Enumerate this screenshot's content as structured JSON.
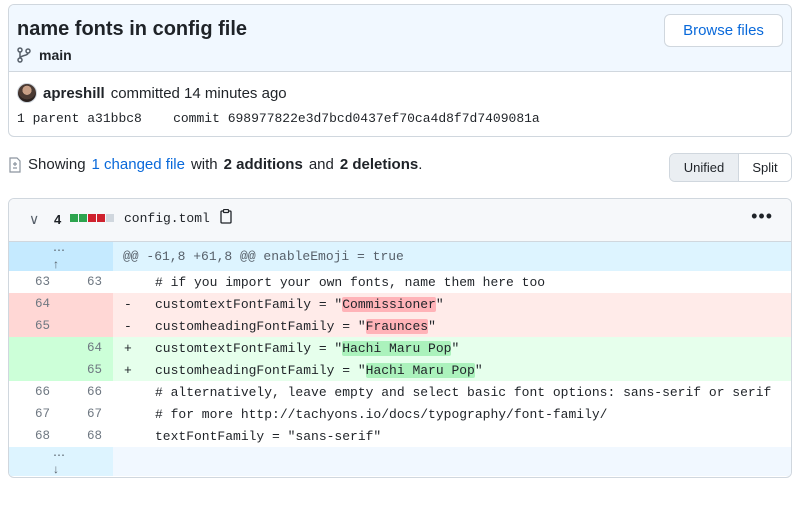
{
  "commit": {
    "title": "name fonts in config file",
    "branch": "main",
    "browse_label": "Browse files",
    "author": "apreshill",
    "action": "committed 14 minutes ago",
    "parent_label": "1 parent",
    "parent_sha": "a31bbc8",
    "commit_label": "commit",
    "commit_sha": "698977822e3d7bcd0437ef70ca4d8f7d7409081a"
  },
  "summary": {
    "showing": "Showing",
    "changed_link": "1 changed file",
    "with": "with",
    "additions": "2 additions",
    "and": "and",
    "deletions": "2 deletions",
    "period": "."
  },
  "view": {
    "unified": "Unified",
    "split": "Split"
  },
  "file": {
    "count": "4",
    "name": "config.toml",
    "diffstat": [
      "add",
      "add",
      "del",
      "del",
      "neutral"
    ],
    "colors": {
      "add": "#2da44e",
      "del": "#cf222e",
      "neutral": "#d0d7de"
    }
  },
  "diff": {
    "hunk_header": "@@ -61,8 +61,8 @@ enableEmoji = true",
    "lines": [
      {
        "type": "ctx",
        "old": "63",
        "new": "63",
        "sign": "",
        "pre": "# if you import your own fonts, name them here too",
        "hl": "",
        "post": ""
      },
      {
        "type": "del",
        "old": "64",
        "new": "",
        "sign": "-",
        "pre": "customtextFontFamily = \"",
        "hl": "Commissioner",
        "post": "\""
      },
      {
        "type": "del",
        "old": "65",
        "new": "",
        "sign": "-",
        "pre": "customheadingFontFamily = \"",
        "hl": "Fraunces",
        "post": "\""
      },
      {
        "type": "add",
        "old": "",
        "new": "64",
        "sign": "+",
        "pre": "customtextFontFamily = \"",
        "hl": "Hachi Maru Pop",
        "post": "\""
      },
      {
        "type": "add",
        "old": "",
        "new": "65",
        "sign": "+",
        "pre": "customheadingFontFamily = \"",
        "hl": "Hachi Maru Pop",
        "post": "\""
      },
      {
        "type": "ctx",
        "old": "66",
        "new": "66",
        "sign": "",
        "pre": "# alternatively, leave empty and select basic font options: sans-serif or serif",
        "hl": "",
        "post": ""
      },
      {
        "type": "ctx",
        "old": "67",
        "new": "67",
        "sign": "",
        "pre": "# for more http://tachyons.io/docs/typography/font-family/",
        "hl": "",
        "post": ""
      },
      {
        "type": "ctx",
        "old": "68",
        "new": "68",
        "sign": "",
        "pre": "textFontFamily = \"sans-serif\"",
        "hl": "",
        "post": ""
      }
    ]
  }
}
